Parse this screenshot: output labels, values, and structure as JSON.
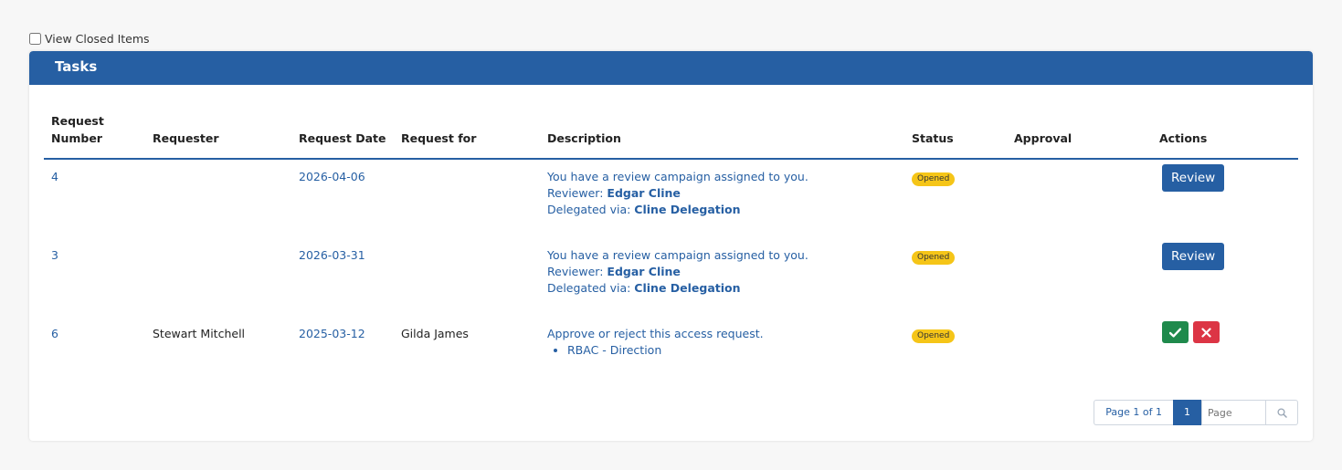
{
  "filter": {
    "view_closed_label": "View Closed Items"
  },
  "card": {
    "title": "Tasks"
  },
  "table": {
    "headers": {
      "request_number_1": "Request",
      "request_number_2": "Number",
      "requester": "Requester",
      "request_date": "Request Date",
      "request_for": "Request for",
      "description": "Description",
      "status": "Status",
      "approval": "Approval",
      "actions": "Actions"
    },
    "rows": [
      {
        "number": "4",
        "requester": "",
        "date": "2026-04-06",
        "request_for": "",
        "desc_line": "You have a review campaign assigned to you.",
        "reviewer_label": "Reviewer: ",
        "reviewer": "Edgar Cline",
        "delegated_label": "Delegated via: ",
        "delegation": "Cline Delegation",
        "status": "Opened",
        "action": "Review"
      },
      {
        "number": "3",
        "requester": "",
        "date": "2026-03-31",
        "request_for": "",
        "desc_line": "You have a review campaign assigned to you.",
        "reviewer_label": "Reviewer: ",
        "reviewer": "Edgar Cline",
        "delegated_label": "Delegated via: ",
        "delegation": "Cline Delegation",
        "status": "Opened",
        "action": "Review"
      },
      {
        "number": "6",
        "requester": "Stewart Mitchell",
        "date": "2025-03-12",
        "request_for": "Gilda James",
        "desc_line": "Approve or reject this access request.",
        "bullet": "RBAC - Direction",
        "status": "Opened",
        "approve_icon": "check-icon",
        "reject_icon": "x-icon"
      }
    ]
  },
  "pager": {
    "info": "Page 1 of 1",
    "current": "1",
    "page_placeholder": "Page",
    "search_icon": "search-icon"
  },
  "colors": {
    "primary": "#265fa3",
    "badge": "#f5c518",
    "approve": "#1f8a4c",
    "reject": "#dc3545"
  }
}
